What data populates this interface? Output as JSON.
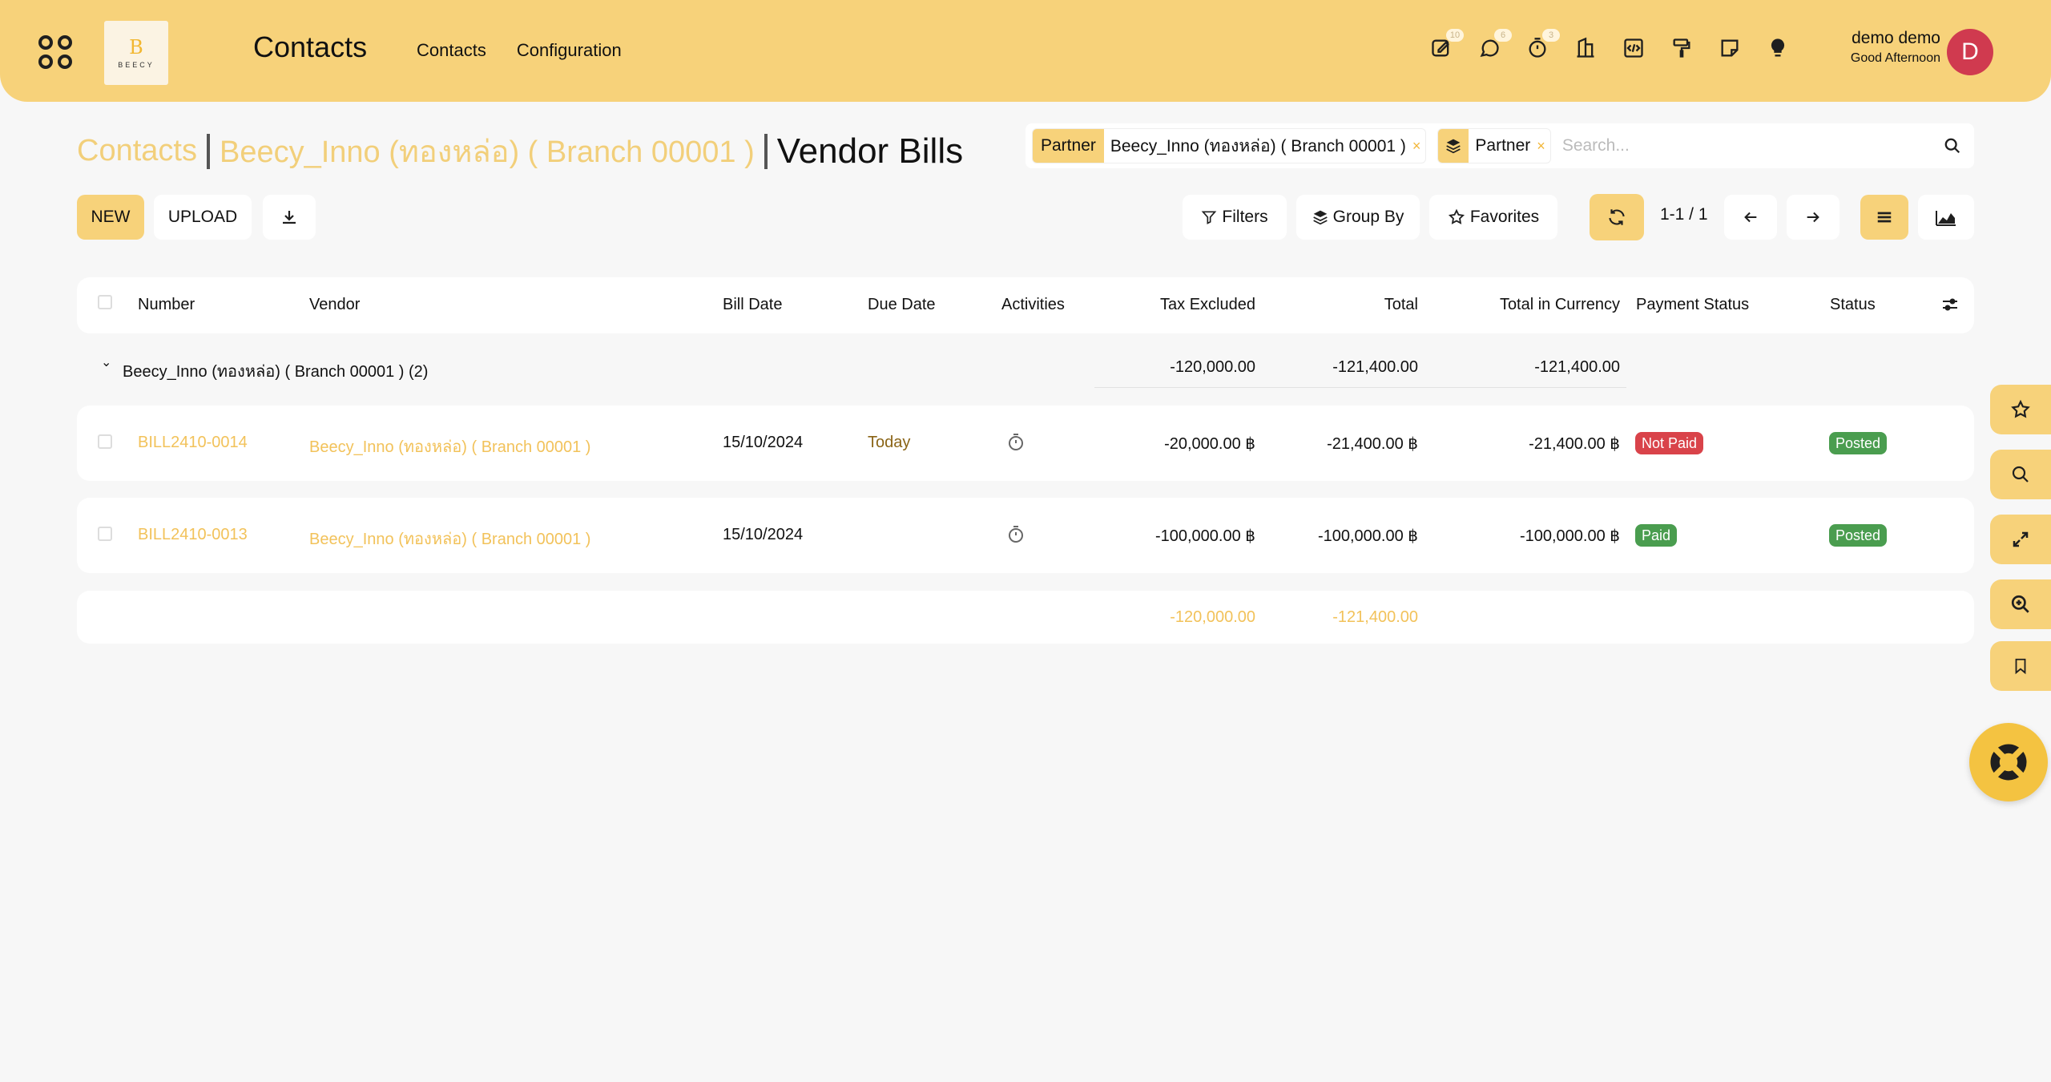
{
  "navbar": {
    "logo_text": "BEECY",
    "app_title": "Contacts",
    "menu": [
      {
        "label": "Contacts"
      },
      {
        "label": "Configuration"
      }
    ],
    "systray": [
      {
        "icon": "activity-edit-icon",
        "count": "10"
      },
      {
        "icon": "chat-icon",
        "count": "6"
      },
      {
        "icon": "stopwatch-icon",
        "count": "3"
      },
      {
        "icon": "building-icon"
      },
      {
        "icon": "code-icon"
      },
      {
        "icon": "paint-roller-icon"
      },
      {
        "icon": "sticky-note-icon"
      },
      {
        "icon": "lightbulb-icon"
      }
    ],
    "user": {
      "name": "demo demo",
      "greeting": "Good Afternoon",
      "initial": "D",
      "avatar_color": "#d03a4f"
    }
  },
  "breadcrumb": {
    "items": [
      "Contacts",
      "Beecy_Inno (ทองหล่อ) ( Branch 00001 )"
    ],
    "current": "Vendor Bills"
  },
  "search": {
    "facets": [
      {
        "label": "Partner",
        "value": "Beecy_Inno (ทองหล่อ) ( Branch 00001 )"
      },
      {
        "label": "Partner",
        "icon": "layers-icon"
      }
    ],
    "placeholder": "Search..."
  },
  "control_panel": {
    "new_label": "NEW",
    "upload_label": "UPLOAD",
    "filters_label": "Filters",
    "group_by_label": "Group By",
    "favorites_label": "Favorites",
    "pager": "1-1 / 1"
  },
  "list": {
    "columns": [
      "Number",
      "Vendor",
      "Bill Date",
      "Due Date",
      "Activities",
      "Tax Excluded",
      "Total",
      "Total in Currency",
      "Payment Status",
      "Status"
    ],
    "group": {
      "label": "Beecy_Inno (ทองหล่อ) ( Branch 00001 ) (2)",
      "tax_excluded": "-120,000.00",
      "total": "-121,400.00",
      "total_currency": "-121,400.00"
    },
    "rows": [
      {
        "number": "BILL2410-0014",
        "vendor": "Beecy_Inno (ทองหล่อ) ( Branch 00001 )",
        "bill_date": "15/10/2024",
        "due_date": "Today",
        "tax_excluded": "-20,000.00 ฿",
        "total": "-21,400.00 ฿",
        "total_currency": "-21,400.00 ฿",
        "payment_status": "Not Paid",
        "payment_color": "#d9434a",
        "status": "Posted",
        "status_color": "#4a9d4f"
      },
      {
        "number": "BILL2410-0013",
        "vendor": "Beecy_Inno (ทองหล่อ) ( Branch 00001 )",
        "bill_date": "15/10/2024",
        "due_date": "",
        "tax_excluded": "-100,000.00 ฿",
        "total": "-100,000.00 ฿",
        "total_currency": "-100,000.00 ฿",
        "payment_status": "Paid",
        "payment_color": "#4a9d4f",
        "status": "Posted",
        "status_color": "#4a9d4f"
      }
    ],
    "footer": {
      "tax_excluded": "-120,000.00",
      "total": "-121,400.00"
    }
  },
  "side_buttons": [
    "star-icon",
    "search-icon",
    "expand-icon",
    "zoom-in-icon",
    "bookmark-icon"
  ],
  "colors": {
    "accent": "#f7d27a",
    "link": "#f2c25a",
    "background": "#f7f7f7"
  }
}
